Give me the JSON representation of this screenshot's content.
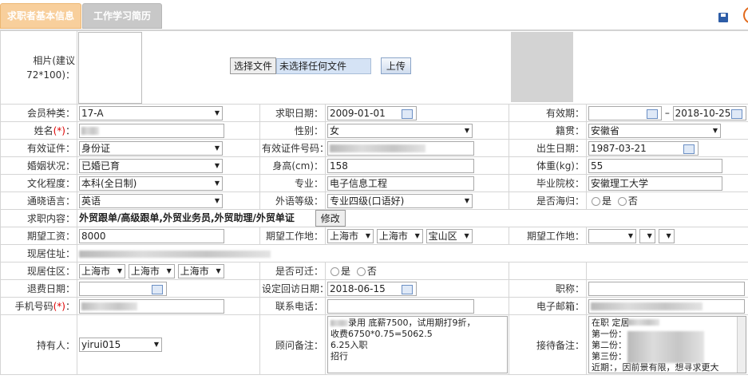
{
  "tabs": [
    "求职者基本信息",
    "工作学习简历"
  ],
  "photo": {
    "label": "相片(建议72*100)：",
    "choose_file": "选择文件",
    "no_file": "未选择任何文件",
    "upload": "上传"
  },
  "row1": {
    "l1": "会员种类：",
    "v1": "17-A",
    "l2": "求职日期：",
    "v2": "2009-01-01",
    "l3": "有效期：",
    "v3a": "",
    "dash": "–",
    "v3b": "2018-10-25"
  },
  "row2": {
    "l1": "姓名",
    "req": "(*)",
    "colon": "：",
    "l2": "性别：",
    "v2": "女",
    "l3": "籍贯：",
    "v3": "安徽省"
  },
  "row3": {
    "l1": "有效证件：",
    "v1": "身份证",
    "l2": "有效证件号码：",
    "l3": "出生日期：",
    "v3": "1987-03-21"
  },
  "row4": {
    "l1": "婚姻状况：",
    "v1": "已婚已育",
    "l2": "身高(cm)：",
    "v2": "158",
    "l3": "体重(kg)：",
    "v3": "55"
  },
  "row5": {
    "l1": "文化程度：",
    "v1": "本科(全日制)",
    "l2": "专业：",
    "v2": "电子信息工程",
    "l3": "毕业院校：",
    "v3": "安徽理工大学"
  },
  "row6": {
    "l1": "通晓语言：",
    "v1": "英语",
    "l2": "外语等级：",
    "v2": "专业四级(口语好)",
    "l3": "是否海归：",
    "o1": "是",
    "o2": "否"
  },
  "row7": {
    "l1": "求职内容：",
    "v1": "外贸跟单/高级跟单,外贸业务员,外贸助理/外贸单证",
    "btn": "修改"
  },
  "row8": {
    "l1": "期望工资：",
    "v1": "8000",
    "l2": "期望工作地：",
    "a": "上海市",
    "b": "上海市",
    "c": "宝山区",
    "l3": "期望工作地："
  },
  "row9": {
    "l1": "现居住址："
  },
  "row10": {
    "l1": "现居住区：",
    "a": "上海市",
    "b": "上海市",
    "c": "上海市",
    "l2": "是否可迁：",
    "o1": "是",
    "o2": "否"
  },
  "row11": {
    "l1": "退费日期：",
    "l2": "设定回访日期：",
    "v2": "2018-06-15",
    "l3": "职称："
  },
  "row12": {
    "l1": "手机号码",
    "req": "(*)",
    "colon": "：",
    "l2": "联系电话：",
    "l3": "电子邮箱："
  },
  "row13": {
    "l1": "持有人：",
    "v1": "yirui015",
    "l2": "顾问备注：",
    "note": [
      "录用  底薪7500，试用期打9折，",
      "收费6750*0.75=5062.5",
      "6.25入职",
      "招行"
    ],
    "l3": "接待备注：",
    "recv": [
      "在职        定居",
      "第一份：",
      "第二份：",
      "第三份：",
      "近期：，因前景有限，想寻求更大"
    ]
  }
}
